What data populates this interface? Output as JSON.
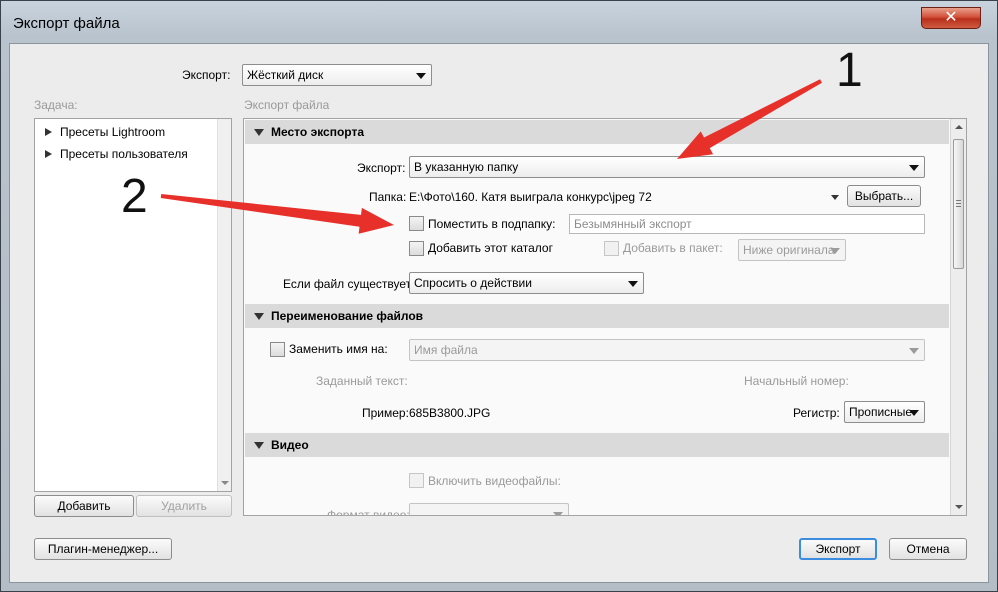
{
  "window": {
    "title": "Экспорт файла",
    "close_glyph": "✕"
  },
  "export_to": {
    "label": "Экспорт:",
    "value": "Жёсткий диск"
  },
  "left": {
    "task_label": "Задача:",
    "tree": [
      "Пресеты Lightroom",
      "Пресеты пользователя"
    ],
    "add": "Добавить",
    "remove": "Удалить"
  },
  "right": {
    "export_file_label": "Экспорт файла",
    "location": {
      "header": "Место экспорта",
      "export_label": "Экспорт:",
      "export_value": "В указанную папку",
      "folder_label": "Папка:",
      "folder_value": "E:\\Фото\\160. Катя выиграла конкурс\\jpeg 72",
      "choose": "Выбрать...",
      "subfolder_label": "Поместить в подпапку:",
      "subfolder_value": "Безымянный экспорт",
      "add_catalog": "Добавить этот каталог",
      "add_stack": "Добавить в пакет:",
      "stack_value": "Ниже оригинала",
      "if_exists_label": "Если файл существует:",
      "if_exists_value": "Спросить о действии"
    },
    "rename": {
      "header": "Переименование файлов",
      "rename_to": "Заменить имя на:",
      "rename_value": "Имя файла",
      "custom_text": "Заданный текст:",
      "start_number": "Начальный номер:",
      "example_label": "Пример:",
      "example_value": "685B3800.JPG",
      "case_label": "Регистр:",
      "case_value": "Прописные"
    },
    "video": {
      "header": "Видео",
      "include": "Включить видеофайлы:",
      "format_label": "Формат видео:"
    }
  },
  "footer": {
    "plugin_manager": "Плагин-менеджер...",
    "export": "Экспорт",
    "cancel": "Отмена"
  },
  "annotations": {
    "one": "1",
    "two": "2",
    "arrow_color": "#e8302a"
  }
}
